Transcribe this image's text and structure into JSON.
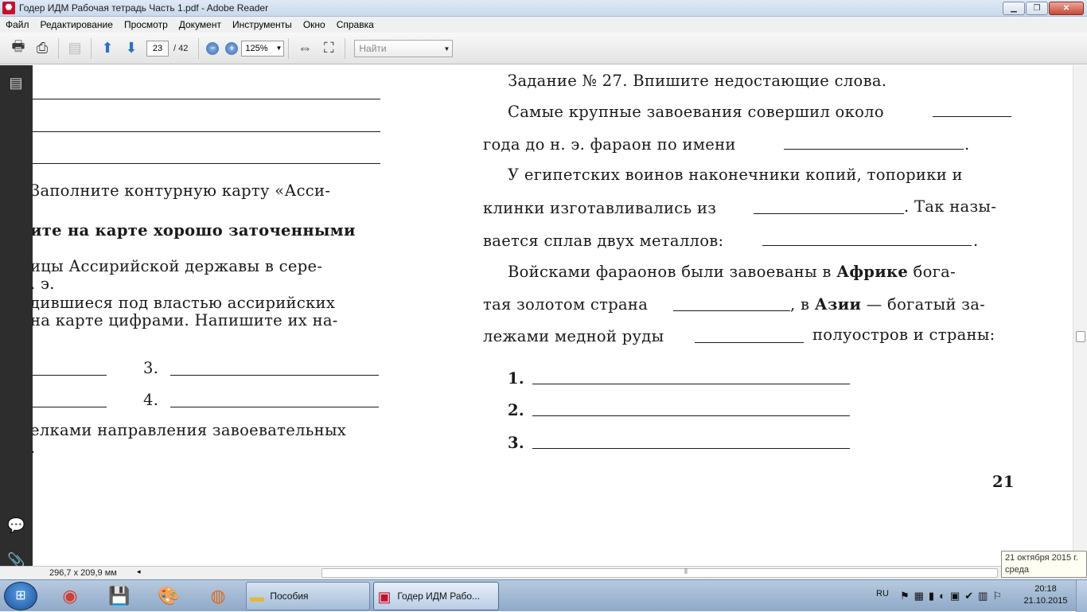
{
  "window": {
    "title": "Годер ИДМ Рабочая тетрадь Часть 1.pdf - Adobe Reader",
    "min_label": "▁",
    "max_label": "❐",
    "close_label": "✕"
  },
  "menu": {
    "items": [
      "Файл",
      "Редактирование",
      "Просмотр",
      "Документ",
      "Инструменты",
      "Окно",
      "Справка"
    ]
  },
  "toolbar": {
    "current_page": "23",
    "total_pages": "/ 42",
    "zoom": "125%",
    "search_placeholder": "Найти"
  },
  "doc": {
    "left_page": {
      "line1": "Заполните контурную карту «Асси-",
      "line2": "ите на карте хорошо заточенными",
      "line3": "ицы Ассирийской державы в сере-",
      "line4": ". э.",
      "line5": "дившиеся под властью ассирийских",
      "line6": "на карте цифрами. Напишите их на-",
      "num3": "3.",
      "num4": "4.",
      "line7": "елками направления завоевательных",
      "line8": "."
    },
    "right_page": {
      "task_title": "Задание № 27. Впишите недостающие слова.",
      "p1a": "Самые крупные завоевания совершил около",
      "p1b": "года до н. э. фараон по имени",
      "p1b_end": ".",
      "p2a": "У египетских воинов наконечники копий, топорики и",
      "p2b_start": "клинки изготавливались из",
      "p2b_end": ". Так назы-",
      "p2c_start": "вается сплав двух металлов:",
      "p2c_end": ".",
      "p3a_start": "Войсками фараонов были завоеваны в",
      "p3a_bold": "Африке",
      "p3a_end": "бога-",
      "p3b_start": "тая золотом страна",
      "p3b_mid": ", в",
      "p3b_bold": "Азии",
      "p3b_end": "— богатый за-",
      "p3c_start": "лежами медной руды",
      "p3c_end": "полуостров и страны:",
      "item1": "1.",
      "item2": "2.",
      "item3": "3.",
      "page_number": "21"
    }
  },
  "status": {
    "dimensions": "296,7 x 209,9 мм"
  },
  "tooltip": {
    "line1": "21 октября 2015 г.",
    "line2": "среда"
  },
  "taskbar": {
    "tasks": [
      {
        "label": "Пособия"
      },
      {
        "label": "Годер ИДМ Рабо..."
      }
    ],
    "lang": "RU",
    "time": "20:18",
    "date": "21.10.2015"
  }
}
